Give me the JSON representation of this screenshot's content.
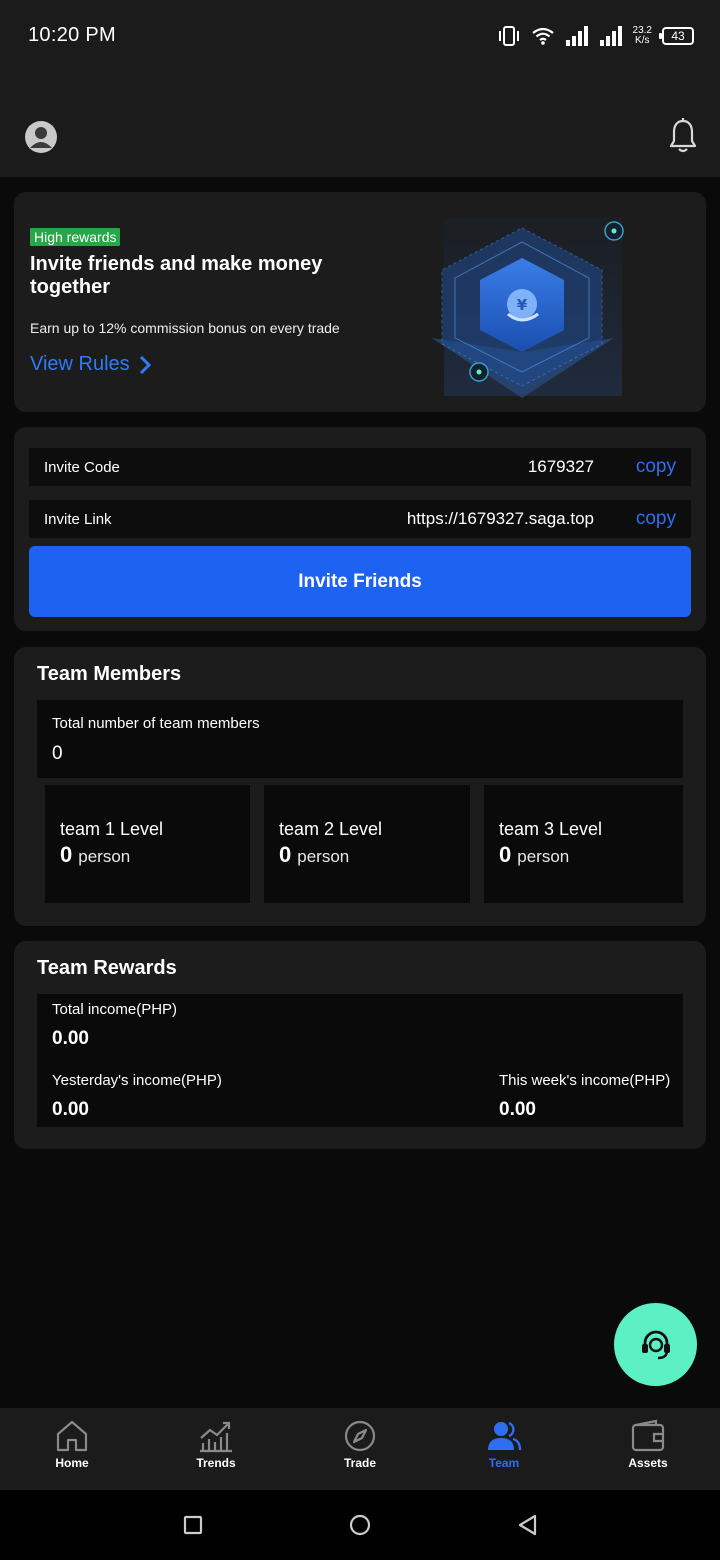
{
  "status_bar": {
    "time": "10:20 PM",
    "speed_value": "23.2",
    "speed_unit": "K/s",
    "battery": "43"
  },
  "banner": {
    "badge": "High rewards",
    "title": "Invite friends and make money together",
    "subtitle": "Earn up to 12% commission bonus on every trade",
    "view_rules": "View Rules",
    "illustration_glyph": "¥"
  },
  "invite": {
    "code_label": "Invite Code",
    "code_value": "1679327",
    "link_label": "Invite Link",
    "link_value": "https://1679327.saga.top",
    "copy_label": "copy",
    "button_label": "Invite Friends"
  },
  "team_members": {
    "title": "Team Members",
    "total_label": "Total number of team members",
    "total_value": "0",
    "levels": [
      {
        "name": "team 1 Level",
        "count": "0",
        "unit": "person"
      },
      {
        "name": "team 2 Level",
        "count": "0",
        "unit": "person"
      },
      {
        "name": "team 3 Level",
        "count": "0",
        "unit": "person"
      }
    ]
  },
  "team_rewards": {
    "title": "Team Rewards",
    "total_label": "Total income(PHP)",
    "total_value": "0.00",
    "yesterday_label": "Yesterday's income(PHP)",
    "yesterday_value": "0.00",
    "week_label": "This week's income(PHP)",
    "week_value": "0.00"
  },
  "nav": [
    {
      "label": "Home",
      "icon": "home-icon"
    },
    {
      "label": "Trends",
      "icon": "trends-icon"
    },
    {
      "label": "Trade",
      "icon": "compass-icon"
    },
    {
      "label": "Team",
      "icon": "team-icon",
      "active": true
    },
    {
      "label": "Assets",
      "icon": "wallet-icon"
    }
  ],
  "colors": {
    "accent": "#2E6FF2",
    "badge": "#27A64A",
    "fab": "#5EF0C5",
    "card": "#1C1C1C"
  }
}
